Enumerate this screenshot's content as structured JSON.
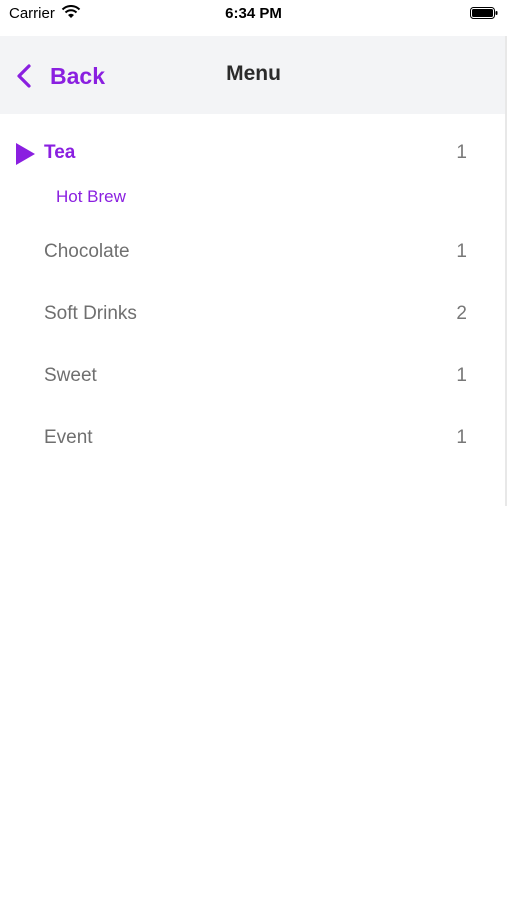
{
  "status_bar": {
    "carrier": "Carrier",
    "time": "6:34 PM"
  },
  "nav": {
    "back_label": "Back",
    "title": "Menu"
  },
  "accent_color": "#8a1fe0",
  "menu": {
    "items": [
      {
        "label": "Tea",
        "count": "1",
        "expanded": true,
        "sub_items": [
          {
            "label": "Hot Brew"
          }
        ]
      },
      {
        "label": "Chocolate",
        "count": "1"
      },
      {
        "label": "Soft Drinks",
        "count": "2"
      },
      {
        "label": "Sweet",
        "count": "1"
      },
      {
        "label": "Event",
        "count": "1"
      }
    ]
  }
}
